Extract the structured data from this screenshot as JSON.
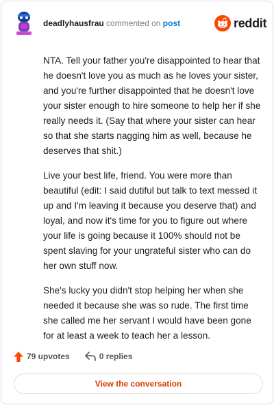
{
  "header": {
    "username": "deadlyhausfrau",
    "action_text": "commented on",
    "post_link": "post",
    "brand_wordmark": "reddit",
    "brand_color": "#ff4500"
  },
  "comment": {
    "paragraphs": [
      "NTA. Tell your father you're disappointed to hear that he doesn't love you as much as he loves your sister, and you're further disappointed that he doesn't love your sister enough to hire someone to help her if she really needs it. (Say that where your sister can hear so that she starts nagging him as well, because he deserves that shit.)",
      "Live your best life, friend. You were more than beautiful (edit: I said dutiful but talk to text messed it up and I'm leaving it because you deserve that) and loyal, and now it's time for you to figure out where your life is going because it 100% should not be spent slaving for your ungrateful sister who can do her own stuff now.",
      "She's lucky you didn't stop helping her when she needed it because she was so rude. The first time she called me her servant I would have been gone for at least a week to teach her a lesson."
    ]
  },
  "actions": {
    "upvotes": "79 upvotes",
    "replies": "0 replies",
    "upvote_icon": "upvote-arrow-icon",
    "reply_icon": "reply-arrow-icon"
  },
  "cta": {
    "label": "View the conversation",
    "color": "#d93a00"
  }
}
